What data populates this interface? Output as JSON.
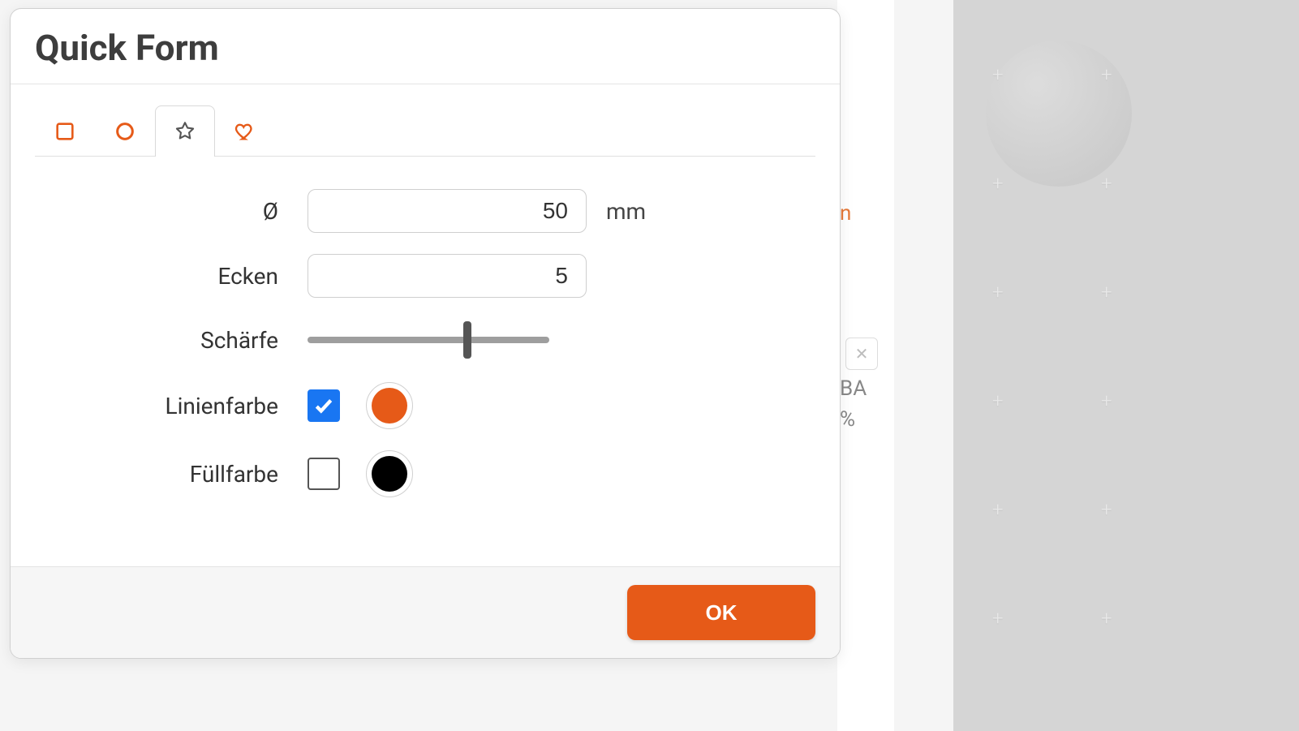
{
  "modal": {
    "title": "Quick Form",
    "tabs": {
      "active_index": 2,
      "items": [
        "square",
        "circle",
        "star",
        "heart"
      ]
    },
    "fields": {
      "diameter": {
        "label": "Ø",
        "value": "50",
        "unit": "mm"
      },
      "corners": {
        "label": "Ecken",
        "value": "5"
      },
      "sharpness": {
        "label": "Schärfe",
        "value": 0.66
      },
      "linecolor": {
        "label": "Linienfarbe",
        "enabled": true,
        "color": "#e65a18"
      },
      "fillcolor": {
        "label": "Füllfarbe",
        "enabled": false,
        "color": "#000000"
      }
    },
    "ok_label": "OK"
  },
  "background": {
    "frag1": "n",
    "frag2": "BA",
    "frag3": "%"
  }
}
